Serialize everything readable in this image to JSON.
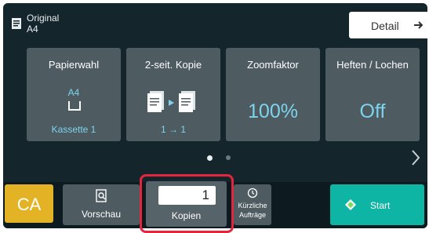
{
  "header": {
    "original_label": "Original",
    "original_size": "A4",
    "detail_label": "Detail"
  },
  "tiles": [
    {
      "title": "Papierwahl",
      "value_top": "A4",
      "value_bottom": "Kassette 1",
      "icon": "paper-tray-icon"
    },
    {
      "title": "2-seit. Kopie",
      "value_bottom": "1 → 1",
      "icon": "duplex-copy-icon"
    },
    {
      "title": "Zoomfaktor",
      "value": "100%"
    },
    {
      "title": "Heften / Lochen",
      "value": "Off"
    }
  ],
  "pager": {
    "page_count": 2,
    "active_page": 1
  },
  "bottom_bar": {
    "ca_label": "CA",
    "preview_label": "Vorschau",
    "copies_value": "1",
    "copies_label": "Kopien",
    "recent_label_line1": "Kürzliche",
    "recent_label_line2": "Aufträge",
    "start_label": "Start"
  },
  "colors": {
    "background": "#15252c",
    "tile": "#4e5c62",
    "accent_value": "#7ed3ec",
    "ca_button": "#e4b325",
    "start_button": "#0fb5a4",
    "highlight_outline": "#e3263d"
  }
}
